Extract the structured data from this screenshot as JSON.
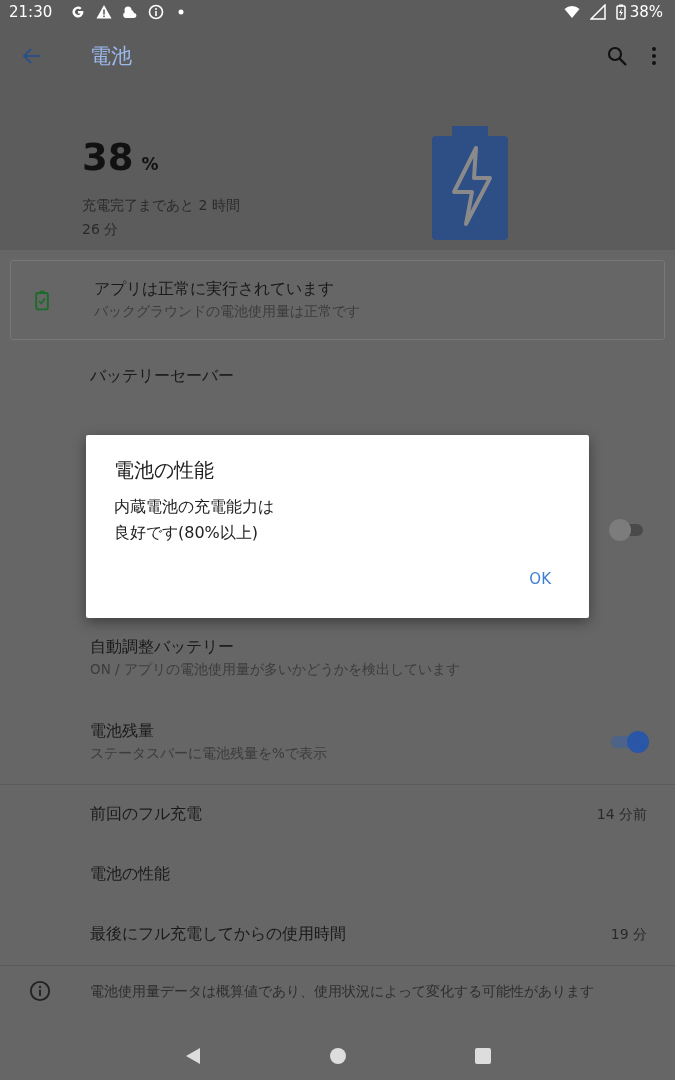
{
  "status_bar": {
    "time": "21:30",
    "battery": "38%"
  },
  "toolbar": {
    "title": "電池"
  },
  "hero": {
    "percent": "38",
    "unit": "%",
    "estimate_line_1": "充電完了まであと 2 時間",
    "estimate_line_2": "26 分"
  },
  "status_card": {
    "title": "アプリは正常に実行されています",
    "subtitle": "バックグラウンドの電池使用量は正常です"
  },
  "settings": [
    {
      "kind": "text",
      "title": "バッテリーセーバー"
    },
    {
      "kind": "toggle",
      "on": false
    },
    {
      "kind": "text",
      "title": "自動調整バッテリー",
      "subtitle": "ON / アプリの電池使用量が多いかどうかを検出しています"
    },
    {
      "kind": "toggle",
      "title": "電池残量",
      "subtitle": "ステータスバーに電池残量を%で表示",
      "on": true
    }
  ],
  "info_rows": [
    {
      "title": "前回のフル充電",
      "value": "14 分前"
    },
    {
      "title": "電池の性能"
    },
    {
      "title": "最後にフル充電してからの使用時間",
      "value": "19 分"
    }
  ],
  "footer_note": "電池使用量データは概算値であり、使用状況によって変化する可能性があります",
  "dialog": {
    "title": "電池の性能",
    "message_line_1": "内蔵電池の充電能力は",
    "message_line_2": "良好です(80%以上)",
    "button": "OK"
  }
}
